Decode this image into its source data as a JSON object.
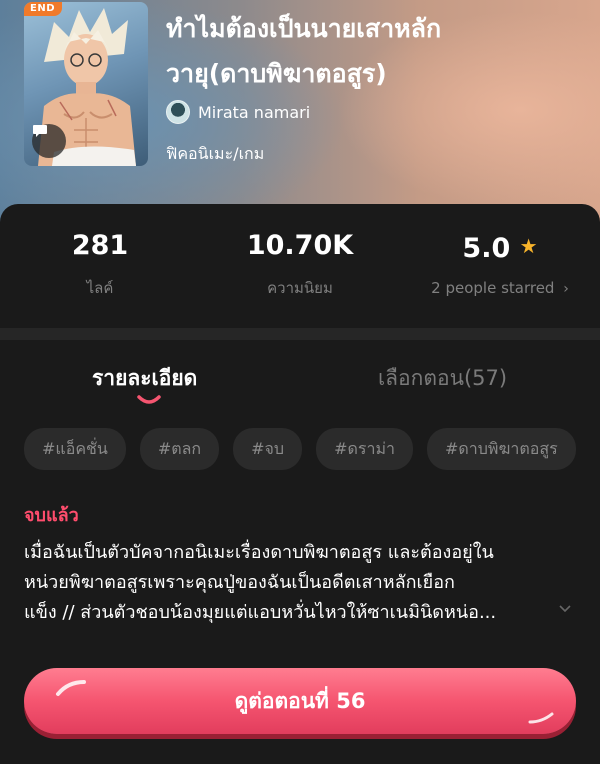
{
  "header": {
    "end_badge": "END",
    "title_line1": "ทำไมต้องเป็นนายเสาหลัก",
    "title_line2": "วายุ(ดาบพิฆาตอสูร)",
    "author": "Mirata namari",
    "genre": "ฟิคอนิเมะ/เกม"
  },
  "stats": {
    "likes_value": "281",
    "likes_label": "ไลค์",
    "popularity_value": "10.70K",
    "popularity_label": "ความนิยม",
    "rating_value": "5.0",
    "rating_label": "2 people starred"
  },
  "tabs": {
    "details": "รายละเอียด",
    "chapters": "เลือกตอน(57)"
  },
  "tags": [
    "#แอ็คชั่น",
    "#ตลก",
    "#จบ",
    "#ดราม่า",
    "#ดาบพิฆาตอสูร"
  ],
  "detail": {
    "status": "จบแล้ว",
    "synopsis_line1": "เมื่อฉันเป็นตัวบัคจากอนิเมะเรื่องดาบพิฆาตอสูร และต้องอยู่ใน",
    "synopsis_line2": "หน่วยพิฆาตอสูรเพราะคุณปู่ของฉันเป็นอดีตเสาหลักเยือก",
    "synopsis_line3": "แข็ง // ส่วนตัวชอบน้องมุยแต่แอบหวั่นไหวให้ซาเนมินิดหน่อ..."
  },
  "cta": {
    "label": "ดูต่อตอนที่ 56"
  },
  "colors": {
    "accent": "#f55570",
    "status": "#ff4d6d",
    "star": "#f7b32b",
    "end_badge": "#f07a2a"
  }
}
